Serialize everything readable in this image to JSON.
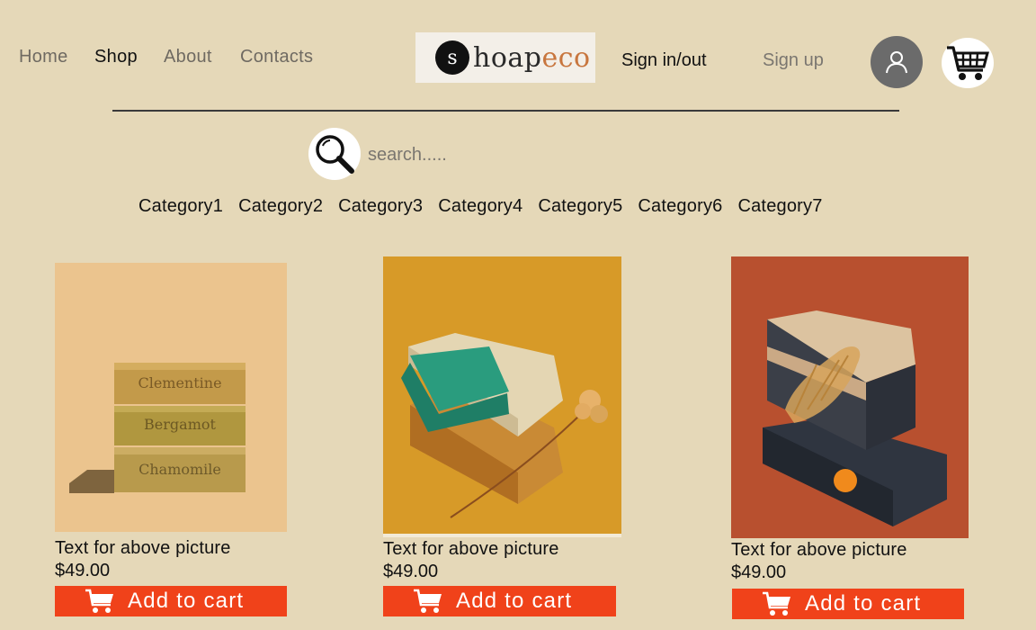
{
  "nav": {
    "home": "Home",
    "shop": "Shop",
    "about": "About",
    "contacts": "Contacts"
  },
  "logo": {
    "mark": "s",
    "text_part1": "hoap",
    "text_part2": "eco"
  },
  "auth": {
    "sign_in_out": "Sign in/out",
    "sign_up": "Sign up"
  },
  "search": {
    "placeholder": "search....."
  },
  "categories": [
    "Category1",
    "Category2",
    "Category3",
    "Category4",
    "Category5",
    "Category6",
    "Category7"
  ],
  "products": [
    {
      "caption": "Text for above picture",
      "price": "$49.00",
      "button": "Add to cart",
      "soap_labels": [
        "Clementine",
        "Bergamot",
        "Chamomile"
      ]
    },
    {
      "caption": "Text for above picture",
      "price": "$49.00",
      "button": "Add to cart"
    },
    {
      "caption": "Text for above picture",
      "price": "$49.00",
      "button": "Add to cart"
    }
  ],
  "colors": {
    "background": "#e5d8b8",
    "add_button": "#f0421a",
    "avatar": "#6b6b6b"
  }
}
